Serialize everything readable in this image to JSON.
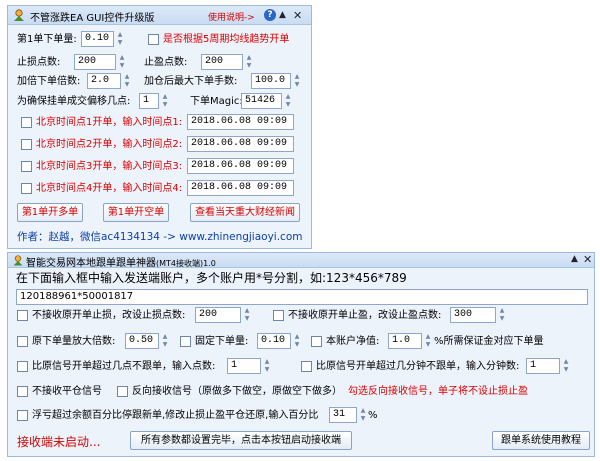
{
  "window1": {
    "title": "不管涨跌EA GUI控件升级版",
    "help_link": "使用说明->",
    "help_button": "?",
    "lot_label": "第1单下单量:",
    "lot_value": "0.10",
    "trend_check_label": "是否根据5周期均线趋势开单",
    "sl_label": "止损点数:",
    "sl_value": "200",
    "tp_label": "止盈点数:",
    "tp_value": "200",
    "mult_label": "加倍下单倍数:",
    "mult_value": "2.0",
    "maxlot_label": "加仓后最大下单手数:",
    "maxlot_value": "100.0",
    "offset_label": "为确保挂单成交偏移几点:",
    "offset_value": "1",
    "magic_label": "下单Magic:",
    "magic_value": "51426",
    "time_rows": [
      {
        "label": "北京时间点1开单，输入时间点1:",
        "value": "2018.06.08 09:09"
      },
      {
        "label": "北京时间点2开单，输入时间点2:",
        "value": "2018.06.08 09:09"
      },
      {
        "label": "北京时间点3开单，输入时间点3:",
        "value": "2018.06.08 09:09"
      },
      {
        "label": "北京时间点4开单，输入时间点4:",
        "value": "2018.06.08 09:09"
      }
    ],
    "buy_button": "第1单开多单",
    "sell_button": "第1单开空单",
    "news_button": "查看当天重大财经新闻",
    "author": "作者：赵越，微信ac4134134 -> www.zhinengjiaoyi.com"
  },
  "window2": {
    "title": "智能交易网本地跟单跟单神器",
    "title_sub": "(MT4接收端)1.0",
    "instruction": "在下面输入框中输入发送端账户，多个账户用*号分割，如:123*456*789",
    "accounts_value": "120188961*50001817",
    "no_sl_label": "不接收原开单止损，改设止损点数:",
    "no_sl_value": "200",
    "no_tp_label": "不接收原开单止盈，改设止盈点数:",
    "no_tp_value": "300",
    "mult_label": "原下单量放大倍数:",
    "mult_value": "0.50",
    "fixed_label": "固定下单量:",
    "fixed_value": "0.10",
    "equity_label": "本账户净值:",
    "equity_value": "1.0",
    "equity_suffix": "%所需保证金对应下单量",
    "compare_points_label": "比原信号开单超过几点不跟单，输入点数:",
    "compare_points_value": "1",
    "compare_minutes_label": "比原信号开单超过几分钟不跟单，输入分钟数:",
    "compare_minutes_value": "1",
    "no_close_label": "不接收平仓信号",
    "reverse_label": "反向接收信号（原做多下做空，原做空下做多）",
    "reverse_note": "勾选反向接收信号，单子将不设止损止盈",
    "float_label": "浮亏超过余额百分比停跟新单,修改止损止盈平仓还原,输入百分比",
    "float_value": "31",
    "float_suffix": "%",
    "status": "接收端未启动...",
    "start_button": "所有参数都设置完毕，点击本按钮启动接收端",
    "tutorial_button": "跟单系统使用教程"
  },
  "colors": {
    "panel_bg": "#edf3fb",
    "red_text": "#d90000",
    "blue_text": "#0b3fa8"
  }
}
